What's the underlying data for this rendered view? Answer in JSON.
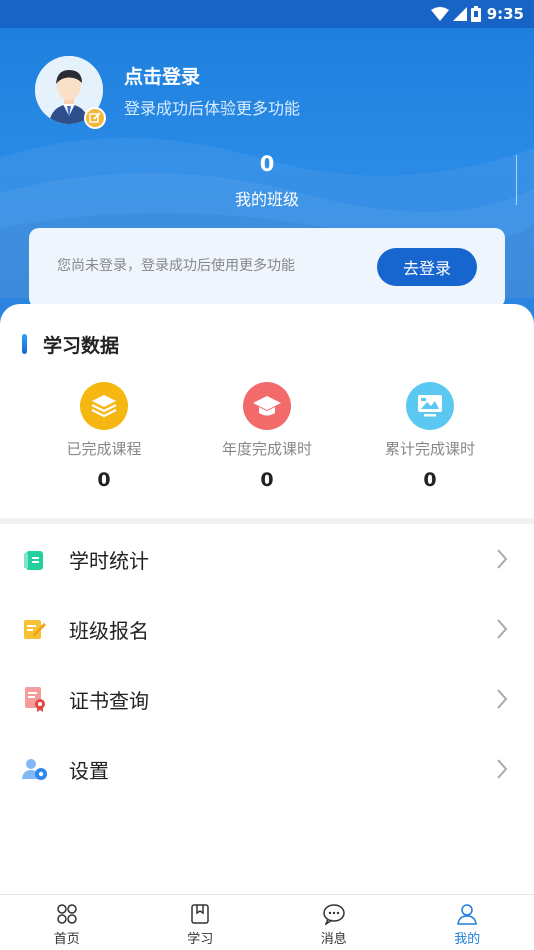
{
  "status_bar": {
    "time": "9:35"
  },
  "profile": {
    "title": "点击登录",
    "subtitle": "登录成功后体验更多功能"
  },
  "class_stat": {
    "count": "0",
    "label": "我的班级"
  },
  "notice": {
    "text": "您尚未登录，登录成功后使用更多功能",
    "button_label": "去登录"
  },
  "study_data": {
    "title": "学习数据",
    "items": [
      {
        "label": "已完成课程",
        "value": "0",
        "icon": "layers-icon",
        "color": "#f6b712"
      },
      {
        "label": "年度完成课时",
        "value": "0",
        "icon": "graduation-cap-icon",
        "color": "#f26a6a"
      },
      {
        "label": "累计完成课时",
        "value": "0",
        "icon": "monitor-icon",
        "color": "#5bc8f2"
      }
    ]
  },
  "menu": {
    "items": [
      {
        "label": "学时统计",
        "icon": "notebook-icon",
        "color": "#24cfa0"
      },
      {
        "label": "班级报名",
        "icon": "edit-note-icon",
        "color": "#f6c233"
      },
      {
        "label": "证书查询",
        "icon": "certificate-icon",
        "color": "#f26a6a"
      },
      {
        "label": "设置",
        "icon": "user-settings-icon",
        "color": "#3a8ef0"
      }
    ]
  },
  "tabbar": {
    "items": [
      {
        "label": "首页",
        "icon": "home-grid-icon"
      },
      {
        "label": "学习",
        "icon": "book-icon"
      },
      {
        "label": "消息",
        "icon": "chat-bubble-icon"
      },
      {
        "label": "我的",
        "icon": "person-icon",
        "active": true
      }
    ]
  },
  "colors": {
    "primary": "#1766cf",
    "accent": "#1e7fde"
  }
}
